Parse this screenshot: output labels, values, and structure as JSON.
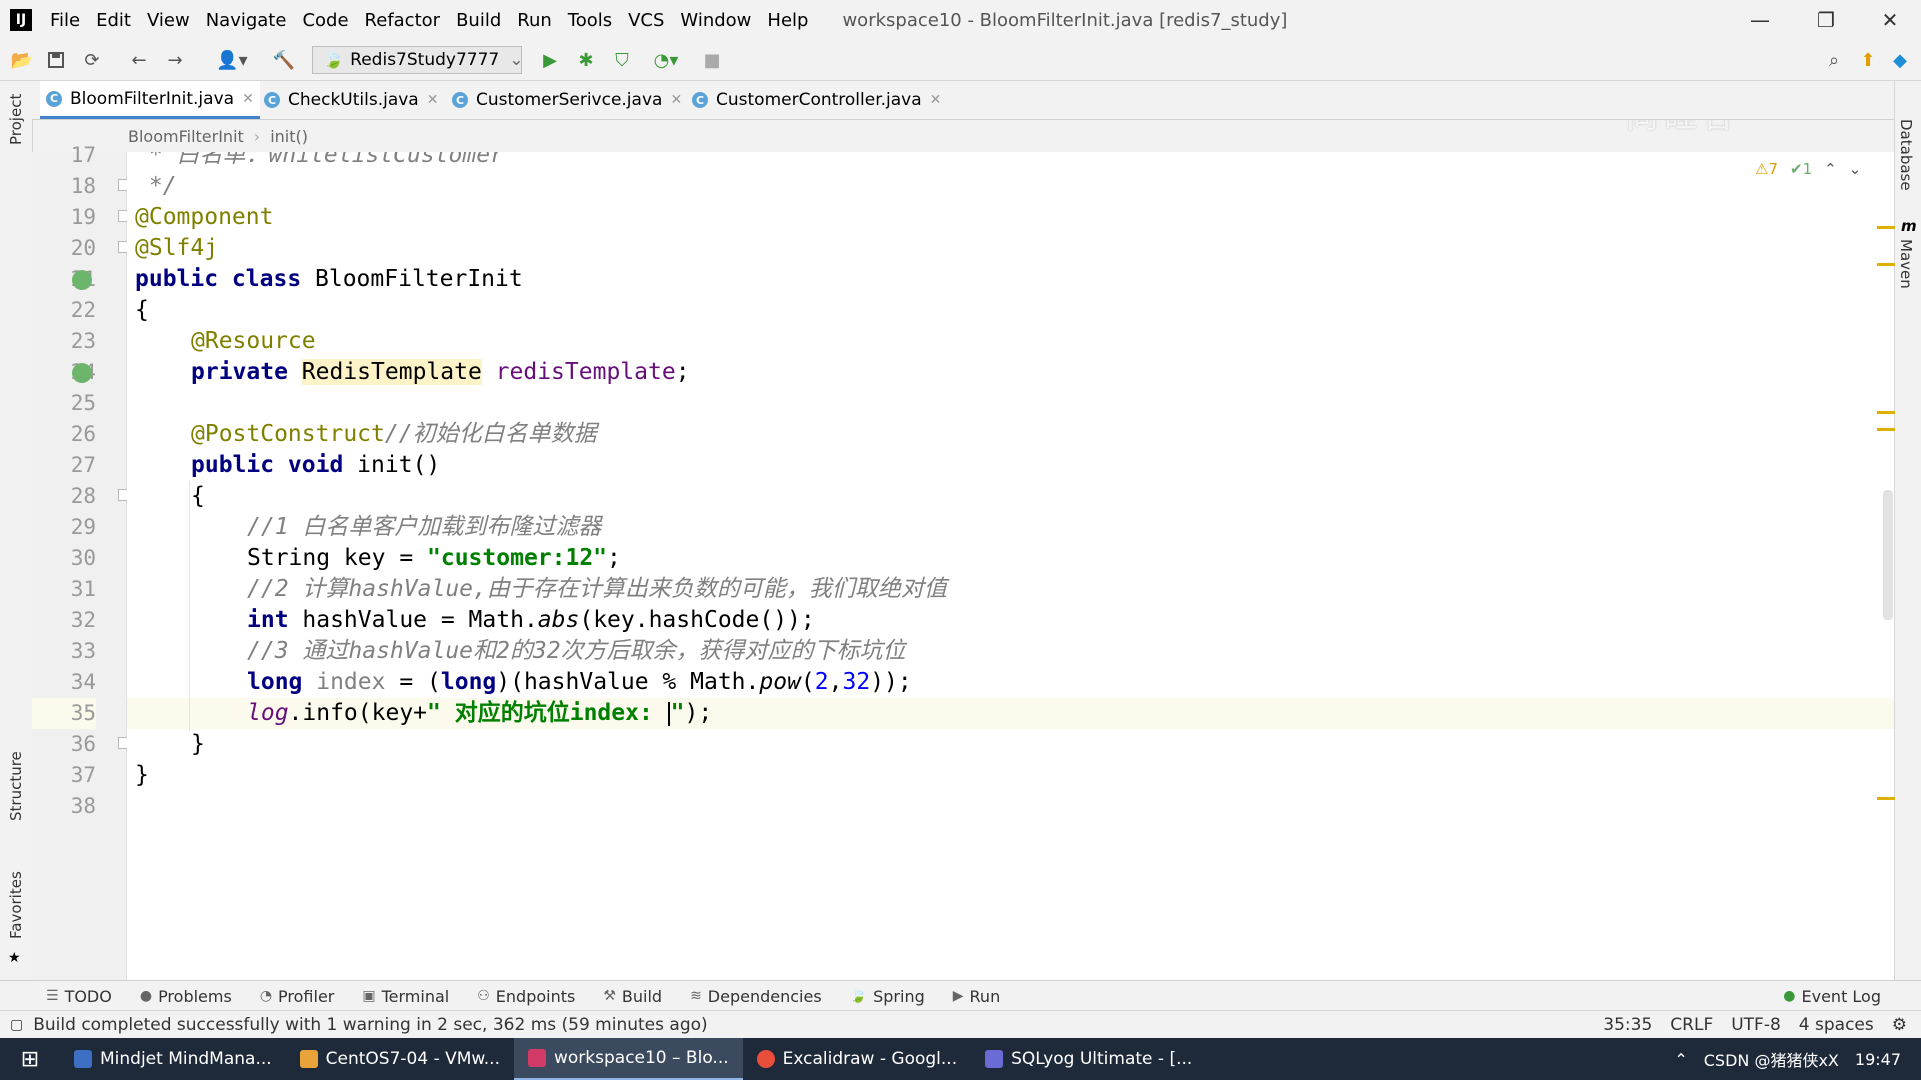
{
  "window": {
    "logo": "IJ",
    "title": "workspace10 - BloomFilterInit.java [redis7_study]",
    "menu": [
      "File",
      "Edit",
      "View",
      "Navigate",
      "Code",
      "Refactor",
      "Build",
      "Run",
      "Tools",
      "VCS",
      "Window",
      "Help"
    ],
    "controls": {
      "minimize": "—",
      "restore": "❐",
      "close": "✕"
    }
  },
  "toolbar": {
    "run_config": "Redis7Study7777",
    "watermark": "尚硅谷"
  },
  "tabs": [
    {
      "label": "BloomFilterInit.java",
      "active": true
    },
    {
      "label": "CheckUtils.java",
      "active": false
    },
    {
      "label": "CustomerSerivce.java",
      "active": false
    },
    {
      "label": "CustomerController.java",
      "active": false
    }
  ],
  "breadcrumb": [
    "BloomFilterInit",
    "init()"
  ],
  "left_sidebar": {
    "project": "Project",
    "structure": "Structure",
    "favorites": "Favorites"
  },
  "right_sidebar": {
    "database": "Database",
    "maven": "Maven"
  },
  "inspections": {
    "warnings": "7",
    "ok": "1"
  },
  "editor": {
    "line_numbers": [
      "17",
      "18",
      "19",
      "20",
      "21",
      "22",
      "23",
      "24",
      "25",
      "26",
      "27",
      "28",
      "29",
      "30",
      "31",
      "32",
      "33",
      "34",
      "35",
      "36",
      "37",
      "38"
    ],
    "line17_comment": " * 白名单：whitelistCustomer",
    "code": {
      "l18": " */",
      "l19": "@Component",
      "l20": "@Slf4j",
      "l21_kw": "public class",
      "l21_name": " BloomFilterInit",
      "l22": "{",
      "l23": "@Resource",
      "l24_kw": "private",
      "l24_type": "RedisTemplate",
      "l24_field": "redisTemplate",
      "l26_ann": "@PostConstruct",
      "l26_cmt": "//初始化白名单数据",
      "l27_kw": "public void",
      "l27_rest": " init()",
      "l28": "{",
      "l29": "//1 白名单客户加载到布隆过滤器",
      "l30_a": "String key = ",
      "l30_str": "\"customer:12\"",
      "l31": "//2 计算hashValue,由于存在计算出来负数的可能，我们取绝对值",
      "l32_kw": "int",
      "l32_a": " hashValue = Math.",
      "l32_it": "abs",
      "l32_b": "(key.hashCode());",
      "l33": "//3 通过hashValue和2的32次方后取余，获得对应的下标坑位",
      "l34_kw": "long",
      "l34_var": " index",
      "l34_a": " = (",
      "l34_cast": "long",
      "l34_b": ")(hashValue % Math.",
      "l34_it": "pow",
      "l34_c": "(",
      "l34_n1": "2",
      "l34_d": ",",
      "l34_n2": "32",
      "l34_e": "));",
      "l35_log": "log",
      "l35_a": ".info(key+",
      "l35_str1": "\" 对应的坑位index: ",
      "l35_str2": "\"",
      "l35_b": ");",
      "l36": "}",
      "l37": "}"
    }
  },
  "tool_tabs": [
    {
      "icon": "list-icon",
      "label": "TODO"
    },
    {
      "icon": "problems-icon",
      "label": "Problems"
    },
    {
      "icon": "profiler-icon",
      "label": "Profiler"
    },
    {
      "icon": "terminal-icon",
      "label": "Terminal"
    },
    {
      "icon": "endpoints-icon",
      "label": "Endpoints"
    },
    {
      "icon": "hammer-icon",
      "label": "Build"
    },
    {
      "icon": "dependencies-icon",
      "label": "Dependencies"
    },
    {
      "icon": "spring-icon",
      "label": "Spring"
    },
    {
      "icon": "run-icon",
      "label": "Run"
    }
  ],
  "event_log": "Event Log",
  "status": {
    "message": "Build completed successfully with 1 warning in 2 sec, 362 ms (59 minutes ago)",
    "position": "35:35",
    "line_sep": "CRLF",
    "encoding": "UTF-8",
    "indent": "4 spaces"
  },
  "taskbar": {
    "items": [
      {
        "label": "Mindjet MindMana...",
        "color": "#3d6fc2"
      },
      {
        "label": "CentOS7-04 - VMw...",
        "color": "#e8a33a"
      },
      {
        "label": "workspace10 – Blo...",
        "color": "#d23a68",
        "active": true
      },
      {
        "label": "Excalidraw - Googl...",
        "color": "#e94e3c"
      },
      {
        "label": "SQLyog Ultimate - [...",
        "color": "#6b6bd6"
      }
    ],
    "tray": "CSDN @猪猪侠xX",
    "clock": "19:47"
  }
}
